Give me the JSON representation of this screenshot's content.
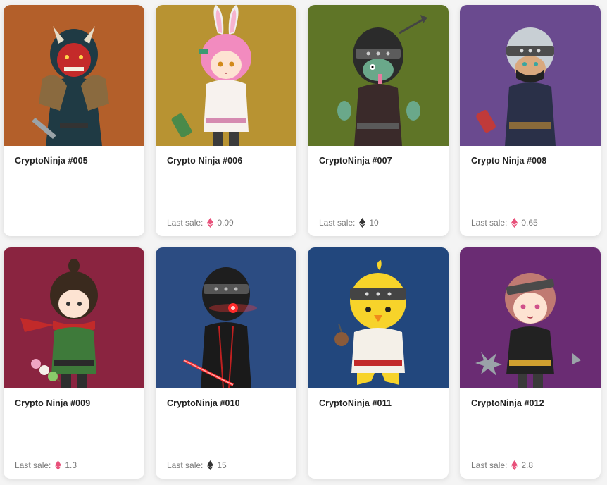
{
  "cards": [
    {
      "name": "CryptoNinja #005",
      "bg": "#b35f2a",
      "sale_label": "",
      "price": "",
      "eth_color": ""
    },
    {
      "name": "Crypto Ninja #006",
      "bg": "#b89332",
      "sale_label": "Last sale:",
      "price": "0.09",
      "eth_color": "#e8507a"
    },
    {
      "name": "CryptoNinja #007",
      "bg": "#5f7527",
      "sale_label": "Last sale:",
      "price": "10",
      "eth_color": "#333333"
    },
    {
      "name": "Crypto Ninja #008",
      "bg": "#6a4a8f",
      "sale_label": "Last sale:",
      "price": "0.65",
      "eth_color": "#e8507a"
    },
    {
      "name": "Crypto Ninja #009",
      "bg": "#8a2440",
      "sale_label": "Last sale:",
      "price": "1.3",
      "eth_color": "#e8507a"
    },
    {
      "name": "CryptoNinja #010",
      "bg": "#2c4c82",
      "sale_label": "Last sale:",
      "price": "15",
      "eth_color": "#333333"
    },
    {
      "name": "CryptoNinja #011",
      "bg": "#22477d",
      "sale_label": "",
      "price": "",
      "eth_color": ""
    },
    {
      "name": "CryptoNinja #012",
      "bg": "#6a2c73",
      "sale_label": "Last sale:",
      "price": "2.8",
      "eth_color": "#e8507a"
    }
  ]
}
